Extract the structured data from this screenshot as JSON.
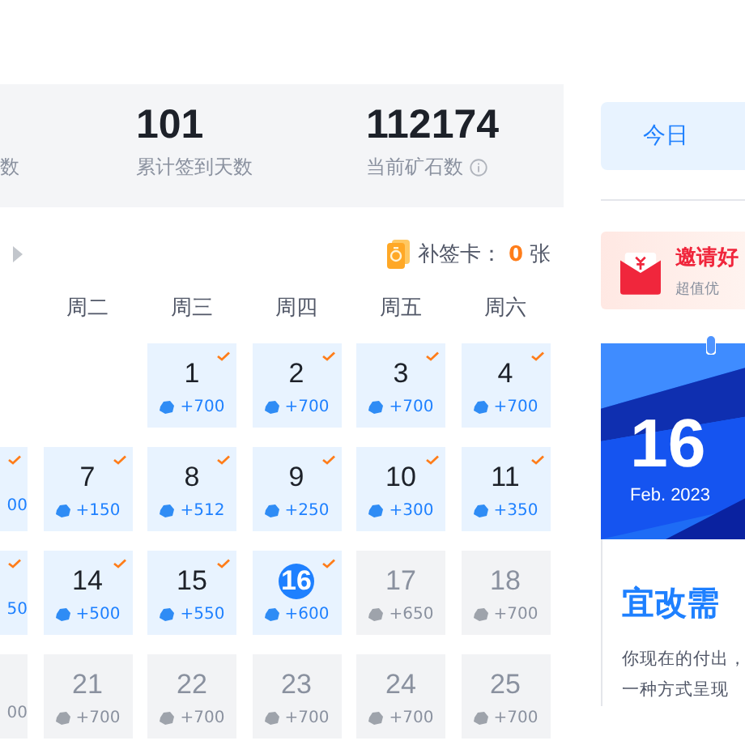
{
  "stats": [
    {
      "label": "数"
    },
    {
      "value": "101",
      "label": "累计签到天数",
      "info": false
    },
    {
      "value": "112174",
      "label": "当前矿石数",
      "info": true
    }
  ],
  "makeup_card": {
    "label": "补签卡：",
    "count": "0",
    "unit": "张"
  },
  "weekdays": [
    "周二",
    "周三",
    "周四",
    "周五",
    "周六"
  ],
  "weeks": [
    {
      "cells": [
        {
          "kind": "empty"
        },
        {
          "kind": "empty"
        },
        {
          "kind": "day",
          "day": "1",
          "reward": "+700",
          "signed": true,
          "today": false
        },
        {
          "kind": "day",
          "day": "2",
          "reward": "+700",
          "signed": true,
          "today": false
        },
        {
          "kind": "day",
          "day": "3",
          "reward": "+700",
          "signed": true,
          "today": false
        },
        {
          "kind": "day",
          "day": "4",
          "reward": "+700",
          "signed": true,
          "today": false
        }
      ]
    },
    {
      "cells": [
        {
          "kind": "partial",
          "reward": "00",
          "signed": true
        },
        {
          "kind": "day",
          "day": "7",
          "reward": "+150",
          "signed": true,
          "today": false
        },
        {
          "kind": "day",
          "day": "8",
          "reward": "+512",
          "signed": true,
          "today": false
        },
        {
          "kind": "day",
          "day": "9",
          "reward": "+250",
          "signed": true,
          "today": false
        },
        {
          "kind": "day",
          "day": "10",
          "reward": "+300",
          "signed": true,
          "today": false
        },
        {
          "kind": "day",
          "day": "11",
          "reward": "+350",
          "signed": true,
          "today": false
        }
      ]
    },
    {
      "cells": [
        {
          "kind": "partial",
          "reward": "50",
          "signed": true
        },
        {
          "kind": "day",
          "day": "14",
          "reward": "+500",
          "signed": true,
          "today": false
        },
        {
          "kind": "day",
          "day": "15",
          "reward": "+550",
          "signed": true,
          "today": false
        },
        {
          "kind": "day",
          "day": "16",
          "reward": "+600",
          "signed": true,
          "today": true
        },
        {
          "kind": "day",
          "day": "17",
          "reward": "+650",
          "signed": false,
          "today": false
        },
        {
          "kind": "day",
          "day": "18",
          "reward": "+700",
          "signed": false,
          "today": false
        }
      ]
    },
    {
      "cells": [
        {
          "kind": "partial",
          "reward": "00",
          "signed": false
        },
        {
          "kind": "day",
          "day": "21",
          "reward": "+700",
          "signed": false,
          "today": false
        },
        {
          "kind": "day",
          "day": "22",
          "reward": "+700",
          "signed": false,
          "today": false
        },
        {
          "kind": "day",
          "day": "23",
          "reward": "+700",
          "signed": false,
          "today": false
        },
        {
          "kind": "day",
          "day": "24",
          "reward": "+700",
          "signed": false,
          "today": false
        },
        {
          "kind": "day",
          "day": "25",
          "reward": "+700",
          "signed": false,
          "today": false
        }
      ]
    }
  ],
  "sign_button": {
    "label": "今日"
  },
  "invite_banner": {
    "title": "邀请好",
    "subtitle": "超值优"
  },
  "daily_card": {
    "day": "16",
    "month": "Feb. 2023",
    "headline": "宜改需",
    "text": "你现在的付出，",
    "text_2": "一种方式呈现"
  }
}
